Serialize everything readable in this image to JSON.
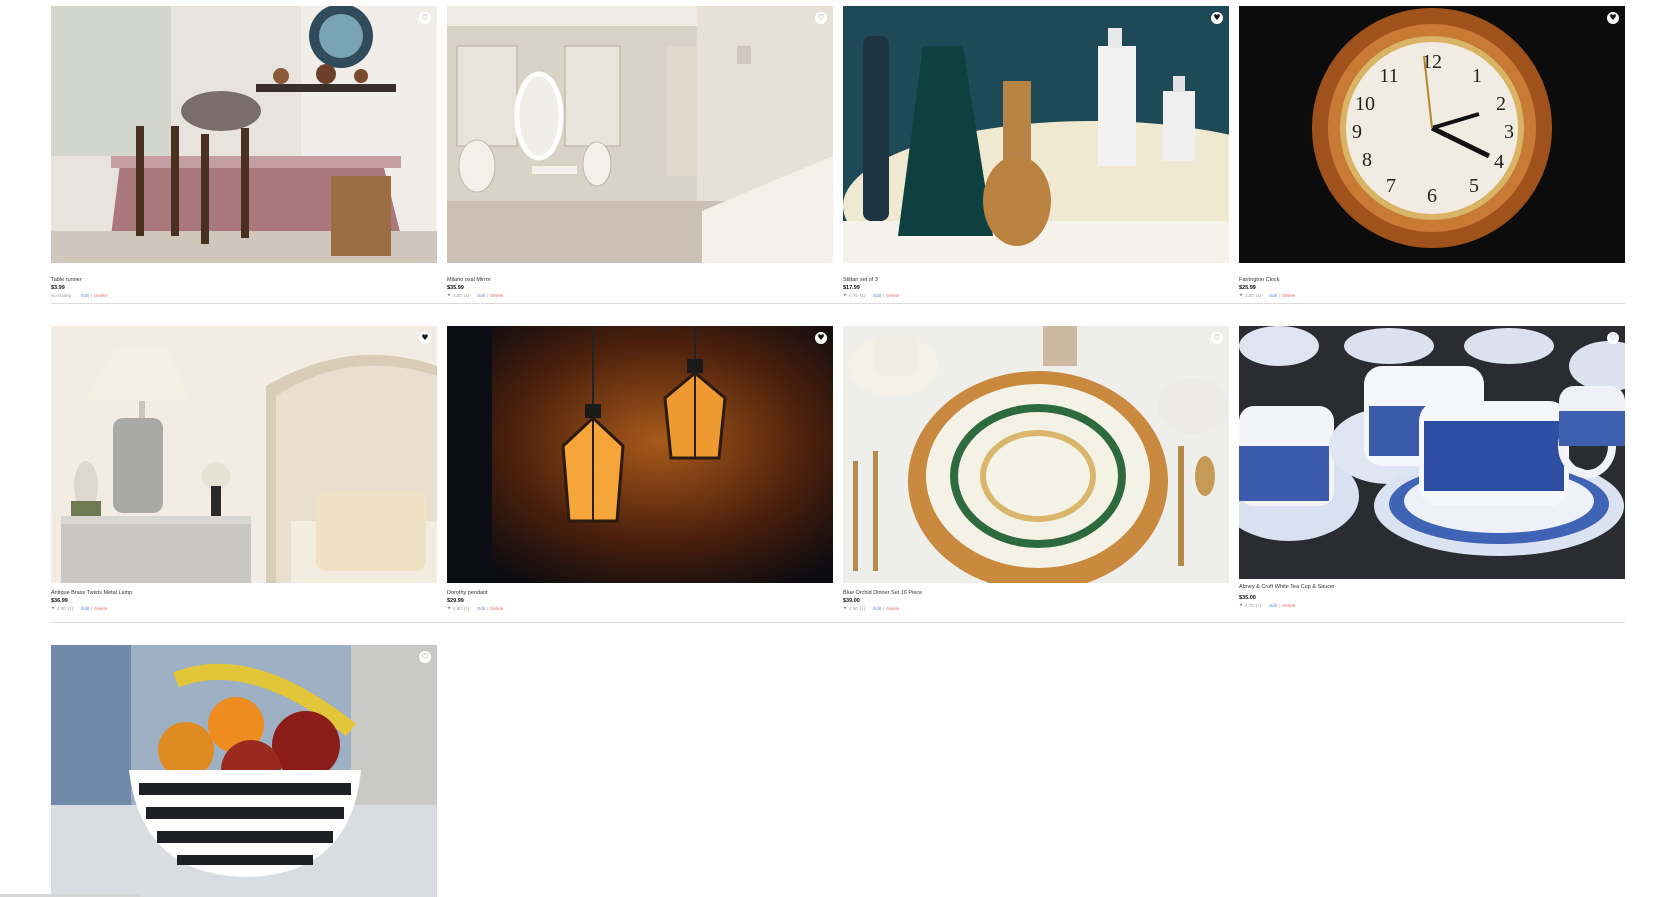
{
  "products": [
    {
      "name": "Table runner",
      "price": "$3.99",
      "rating": "No Rating",
      "rating_info": "",
      "edit_label": "Edit",
      "delete_label": "Delete",
      "favorited": false
    },
    {
      "name": "Milano oval Mirror",
      "price": "$35.99",
      "rating": "4.00",
      "rating_info": "(1)",
      "edit_label": "Edit",
      "delete_label": "Delete",
      "favorited": false
    },
    {
      "name": "Stiltan set of 3",
      "price": "$17.99",
      "rating": "4.75",
      "rating_info": "(1)",
      "edit_label": "Edit",
      "delete_label": "Delete",
      "favorited": true
    },
    {
      "name": "Farrington Clock",
      "price": "$25.99",
      "rating": "3.00",
      "rating_info": "(1)",
      "edit_label": "Edit",
      "delete_label": "Delete",
      "favorited": true
    },
    {
      "name": "Antique Brass Twists Metal Lamp",
      "price": "$36.99",
      "rating": "4.00",
      "rating_info": "(1)",
      "edit_label": "Edit",
      "delete_label": "Delete",
      "favorited": true
    },
    {
      "name": "Dorothy pendant",
      "price": "$29.99",
      "rating": "4.60",
      "rating_info": "(1)",
      "edit_label": "Edit",
      "delete_label": "Delete",
      "favorited": true
    },
    {
      "name": "Blue Orchid Dinner Set 16 Piece",
      "price": "$39.00",
      "rating": "4.50",
      "rating_info": "(1)",
      "edit_label": "Edit",
      "delete_label": "Delete",
      "favorited": false
    },
    {
      "name": "Abney & Croft White Tea Cup & Saucer",
      "price": "$35.00",
      "rating": "4.70",
      "rating_info": "(1)",
      "edit_label": "Edit",
      "delete_label": "Delete",
      "favorited": false
    },
    {
      "name": "",
      "price": "",
      "rating": "",
      "rating_info": "",
      "edit_label": "",
      "delete_label": "",
      "favorited": false
    }
  ],
  "icons": {
    "favorite": "heart-icon",
    "rating": "star-icon"
  },
  "colors": {
    "edit_link": "#5b8fd8",
    "delete_link": "#e36b6b",
    "divider": "#dcdcdc"
  }
}
